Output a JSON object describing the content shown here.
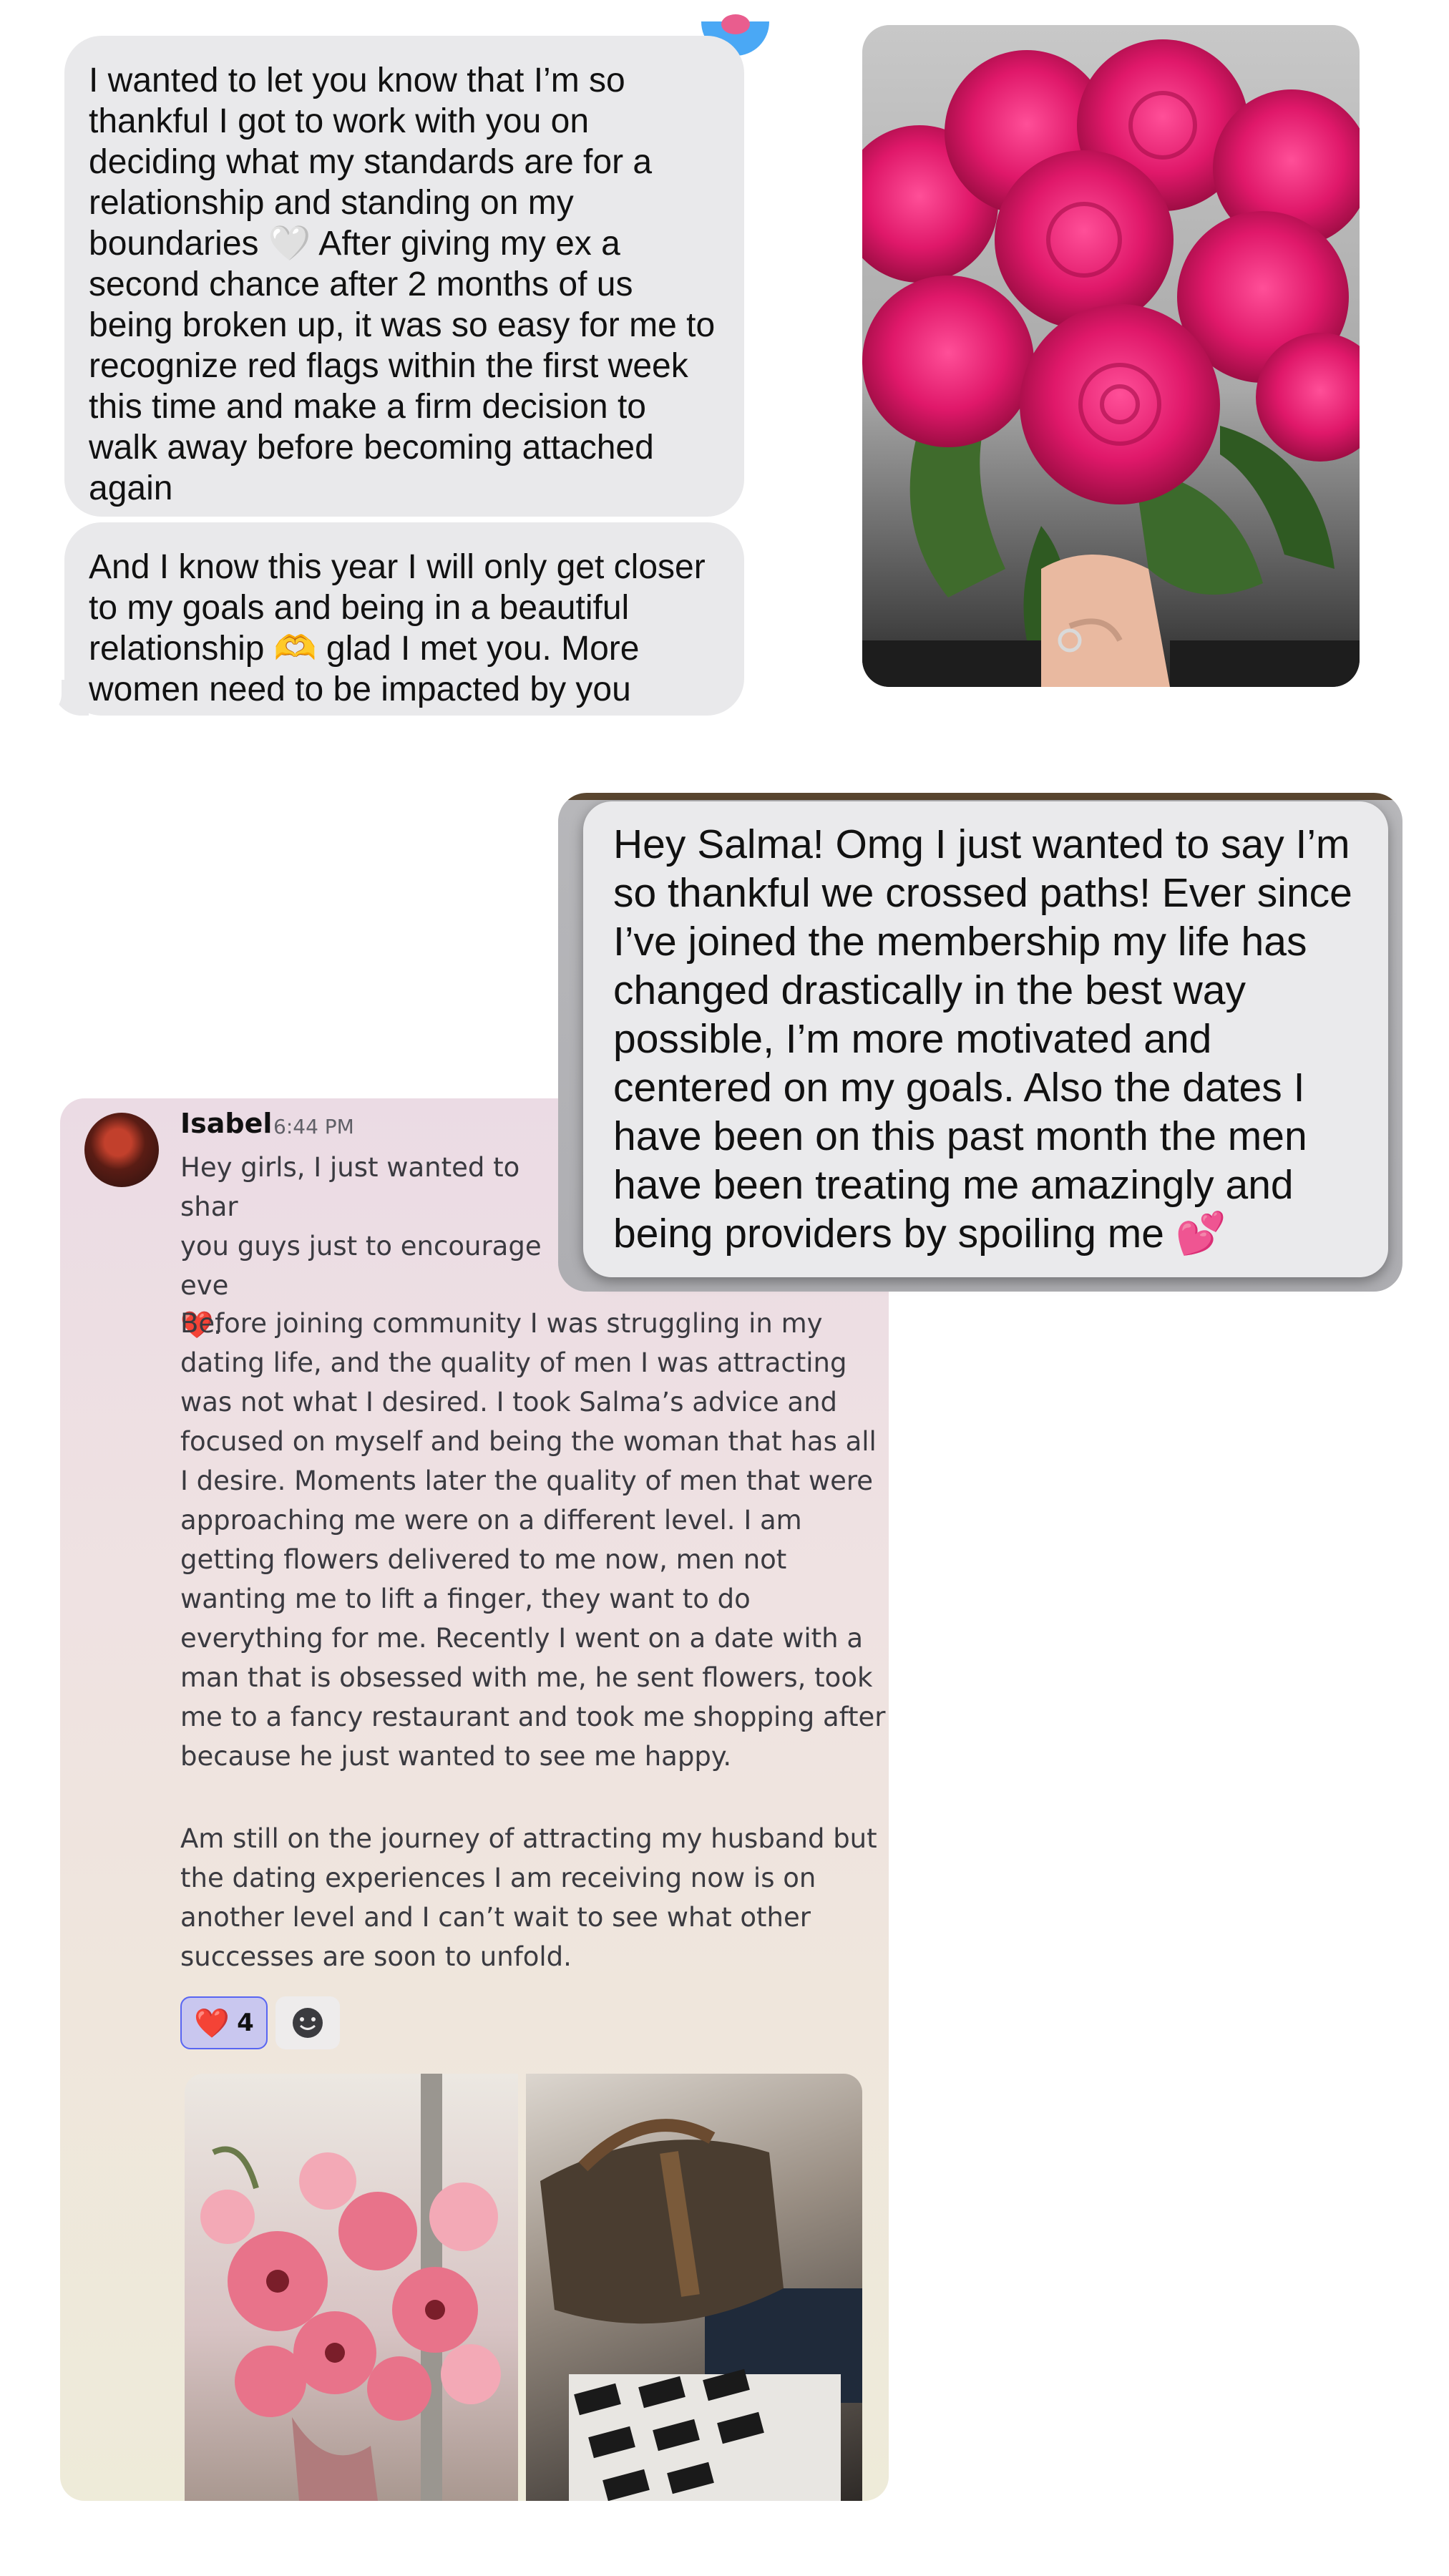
{
  "imessage": {
    "bubble1": "I wanted to let you know that I’m so thankful I got to work with you on deciding what my standards are for a relationship and standing on my boundaries 🤍 After giving my ex a second chance after 2 months of us being broken up, it was so easy for me to recognize red flags within the first week this time and make a firm decision to walk away before becoming attached again",
    "bubble2": "And I know this year I will only get closer to my goals and being in a beautiful relationship 🫶 glad I met you. More women need to be impacted by you"
  },
  "big_message": "Hey Salma! Omg I just wanted to say I’m so thankful we crossed paths! Ever since I’ve joined the membership my life has changed drastically in the best way possible, I’m more motivated and centered on my goals. Also the dates I have been on this past month the men have been treating me amazingly and being providers by spoiling me 💕",
  "discord": {
    "author": "Isabel",
    "timestamp": "6:44 PM",
    "intro": "Hey girls, I just wanted to shar\nyou guys just to encourage eve\n❤️.",
    "paragraph1": "Before joining community I was struggling in my dating life, and the quality of  men I was attracting was not what I desired. I took Salma’s advice and focused on myself and being the woman that has all I desire. Moments later the quality of men that were approaching me were on a different level. I am getting flowers delivered to me now, men not wanting me to lift a finger, they want to do everything for me. Recently I went on a date with a man that is obsessed with me, he sent flowers, took me to a fancy restaurant and took me shopping after because he just wanted to see me happy.",
    "paragraph2": "Am still on the journey of attracting my husband but the dating experiences I am receiving now is on another level and I can’t wait to see what other successes are soon to unfold.",
    "reaction": {
      "emoji": "❤️",
      "count": "4"
    }
  },
  "icons": {
    "reaction_add": "smiley-face-icon",
    "reaction_heart": "heart-icon"
  },
  "colors": {
    "imessage_bubble": "#e9e9eb",
    "reaction_active_bg": "#c9c7ef",
    "reaction_border": "#5865f2",
    "rose_pink": "#e0186a",
    "heart_red": "#e0152b"
  }
}
